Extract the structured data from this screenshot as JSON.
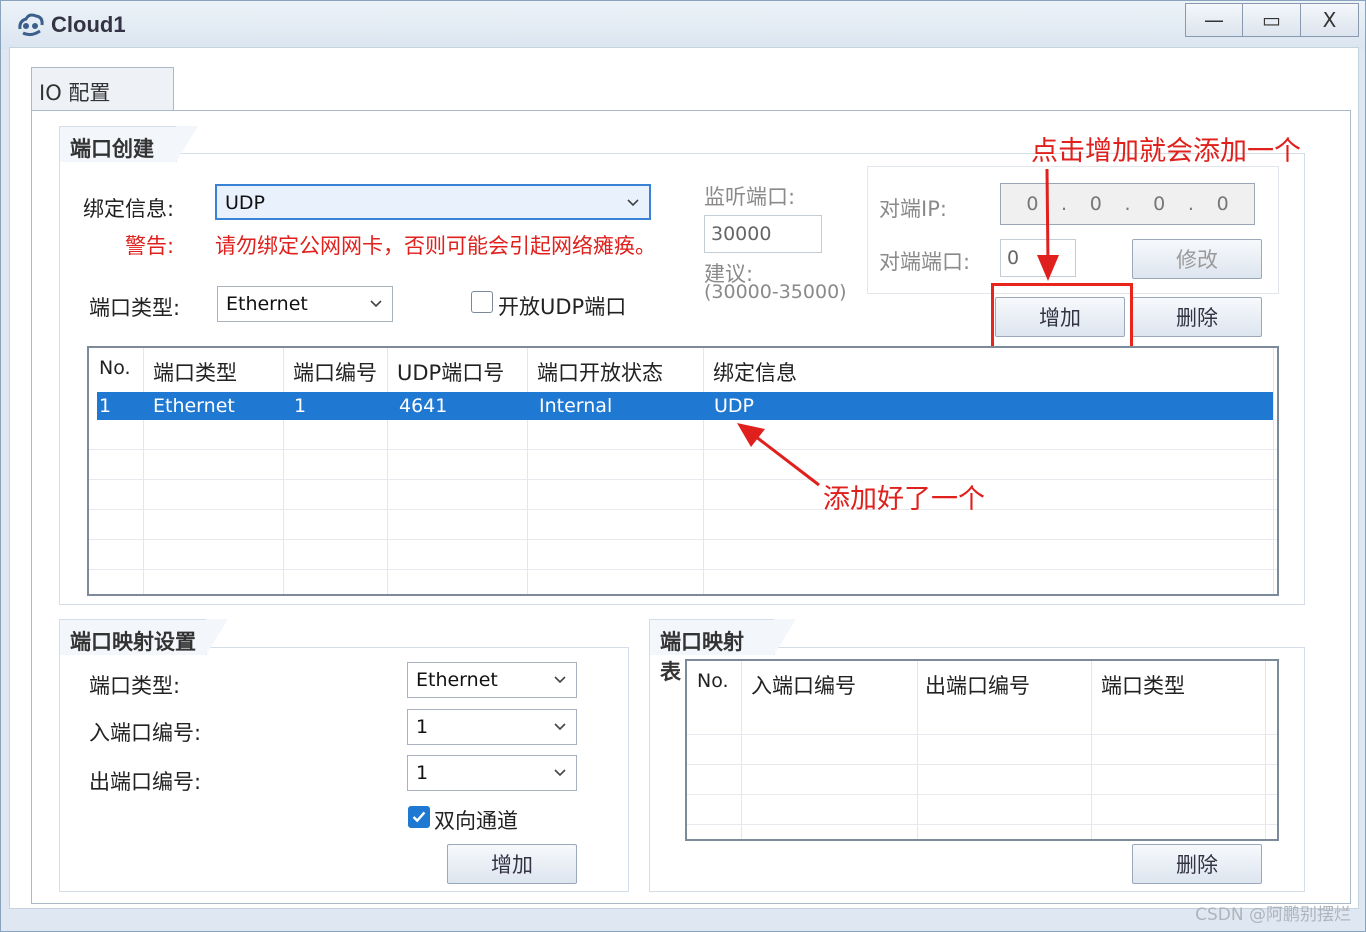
{
  "window": {
    "title": "Cloud1",
    "controls": {
      "minimize": "—",
      "maximize": "▭",
      "close": "X"
    }
  },
  "tabs": [
    {
      "label": "IO 配置"
    }
  ],
  "port_create": {
    "group_title": "端口创建",
    "bind_label": "绑定信息:",
    "bind_value": "UDP",
    "warning_label": "警告:",
    "warning_text": "请勿绑定公网网卡，否则可能会引起网络瘫痪。",
    "port_type_label": "端口类型:",
    "port_type_value": "Ethernet",
    "open_udp_label": "开放UDP端口",
    "listen_port_label": "监听端口:",
    "listen_port_value": "30000",
    "suggest_label": "建议:",
    "suggest_range": "(30000-35000)",
    "peer_ip_label": "对端IP:",
    "peer_ip_octets": [
      "0",
      ".",
      "0",
      ".",
      "0",
      ".",
      "0"
    ],
    "peer_port_label": "对端端口:",
    "peer_port_value": "0",
    "modify_button": "修改",
    "add_button": "增加",
    "delete_button": "删除",
    "table": {
      "columns": [
        "No.",
        "端口类型",
        "端口编号",
        "UDP端口号",
        "端口开放状态",
        "绑定信息"
      ],
      "rows": [
        [
          "1",
          "Ethernet",
          "1",
          "4641",
          "Internal",
          "UDP"
        ]
      ]
    }
  },
  "port_map_settings": {
    "group_title": "端口映射设置",
    "port_type_label": "端口类型:",
    "port_type_value": "Ethernet",
    "in_port_label": "入端口编号:",
    "in_port_value": "1",
    "out_port_label": "出端口编号:",
    "out_port_value": "1",
    "bidirectional_label": "双向通道",
    "bidirectional_checked": true,
    "add_button": "增加"
  },
  "port_map_table": {
    "group_title": "端口映射表",
    "columns": [
      "No.",
      "入端口编号",
      "出端口编号",
      "端口类型"
    ],
    "delete_button": "删除"
  },
  "annotations": {
    "add_hint": "点击增加就会添加一个",
    "added_hint": "添加好了一个"
  },
  "watermark": "CSDN @阿鹏别摆烂",
  "colors": {
    "accent": "#1f78d1",
    "annotation": "#e0201c"
  }
}
